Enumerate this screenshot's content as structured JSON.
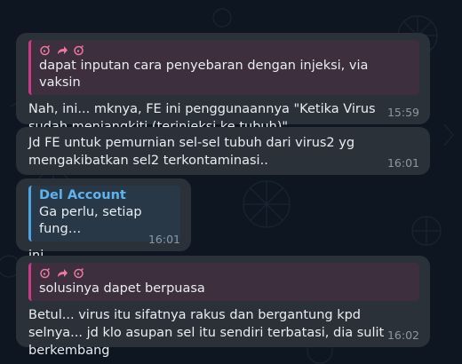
{
  "messages": [
    {
      "quote_text": "dapat inputan cara penyebaran dengan injeksi, via vaksin",
      "text": "Nah, ini... mknya, FE ini penggunaannya \"Ketika Virus sudah menjangkiti (terinjeksi ke tubuh)\"",
      "time": "15:59"
    },
    {
      "text": "Jd FE untuk pemurnian sel-sel tubuh dari virus2 yg mengakibatkan sel2 terkontaminasi..",
      "time": "16:01"
    },
    {
      "quote_name": "Del Account",
      "quote_text": "Ga perlu, setiap fung…",
      "text": "ini..",
      "time": "16:01"
    },
    {
      "quote_text": "solusinya dapet berpuasa",
      "text": "Betul... virus itu sifatnya rakus dan bergantung kpd selnya... jd klo asupan sel itu sendiri terbatasi, dia sulit berkembang",
      "time": "16:02"
    }
  ],
  "colors": {
    "background": "#0e1621",
    "bubble": "#2b3139",
    "quote_accent_pink": "#c93b86",
    "quote_accent_blue": "#4aa6e0",
    "timestamp": "#8b97a4"
  },
  "icons": [
    "bomb-icon",
    "forward-arrow-icon",
    "bomb-icon"
  ]
}
